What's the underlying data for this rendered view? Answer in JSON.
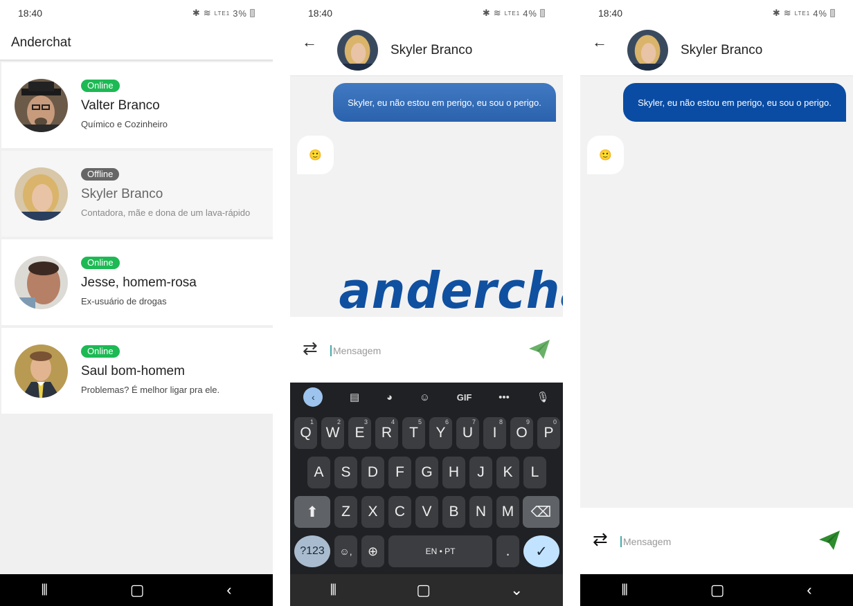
{
  "status": {
    "time": "18:40",
    "battery_s1": "3%",
    "battery_s2": "4%",
    "battery_s3": "4%",
    "net": "LTE1"
  },
  "list_screen": {
    "title": "Anderchat",
    "contacts": [
      {
        "name": "Valter Branco",
        "status": "Online",
        "desc": "Químico e Cozinheiro"
      },
      {
        "name": "Skyler Branco",
        "status": "Offline",
        "desc": "Contadora, mãe e dona de um lava-rápido"
      },
      {
        "name": "Jesse, homem-rosa",
        "status": "Online",
        "desc": "Ex-usuário de drogas"
      },
      {
        "name": "Saul bom-homem",
        "status": "Online",
        "desc": "Problemas? É melhor ligar pra ele."
      }
    ]
  },
  "chat": {
    "name": "Skyler Branco",
    "outgoing": "Skyler, eu não estou em perigo, eu sou o perigo.",
    "incoming": "🙂",
    "wordmark": "anderchat",
    "placeholder": "Mensagem"
  },
  "keyboard": {
    "row1": [
      "Q",
      "W",
      "E",
      "R",
      "T",
      "Y",
      "U",
      "I",
      "O",
      "P"
    ],
    "row1_sup": [
      "1",
      "2",
      "3",
      "4",
      "5",
      "6",
      "7",
      "8",
      "9",
      "0"
    ],
    "row2": [
      "A",
      "S",
      "D",
      "F",
      "G",
      "H",
      "J",
      "K",
      "L"
    ],
    "row3": [
      "Z",
      "X",
      "C",
      "V",
      "B",
      "N",
      "M"
    ],
    "num_key": "?123",
    "space": "EN • PT",
    "period": ".",
    "toolbar": {
      "gif": "GIF"
    }
  },
  "colors": {
    "online": "#1db954",
    "offline": "#666666",
    "accent": "#0a4ca3",
    "send_green": "#2e8b2e"
  }
}
